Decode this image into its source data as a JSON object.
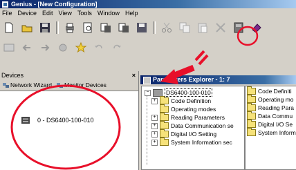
{
  "window": {
    "title": "Genius - [New Configuration]"
  },
  "menu": [
    "File",
    "Device",
    "Edit",
    "View",
    "Tools",
    "Window",
    "Help"
  ],
  "toolbar1": [
    "new-icon",
    "open-icon",
    "save-icon",
    "print-icon",
    "preview-icon",
    "copy-doc-icon",
    "copy-doc2-icon",
    "save-as-icon",
    "cut-icon",
    "copy-icon",
    "paste-icon",
    "delete-icon",
    "device-explorer-icon",
    "eraser-icon"
  ],
  "toolbar2": [
    "grid-icon",
    "back-icon",
    "forward-icon",
    "refresh-icon",
    "star-icon",
    "undo-icon",
    "redo-icon"
  ],
  "devices": {
    "title": "Devices",
    "close": "×",
    "network_wizard": "Network Wizard",
    "monitor_devices": "Monitor Devices",
    "device_label": "0 - DS6400-100-010"
  },
  "params": {
    "title": "Parameters Explorer - 1: 7",
    "root_label": "DS6400-100-010",
    "tree_items": [
      "Code Definition",
      "Operating modes",
      "Reading Parameters",
      "Data Communication se",
      "Digital I/O Setting",
      "System Information sec"
    ],
    "list_items": [
      "Code Definiti",
      "Operating mo",
      "Reading Para",
      "Data Commu",
      "Digital I/O Se",
      "System Inform"
    ]
  },
  "colors": {
    "annotation": "#e8102a",
    "titlebar": "#0a246a"
  }
}
